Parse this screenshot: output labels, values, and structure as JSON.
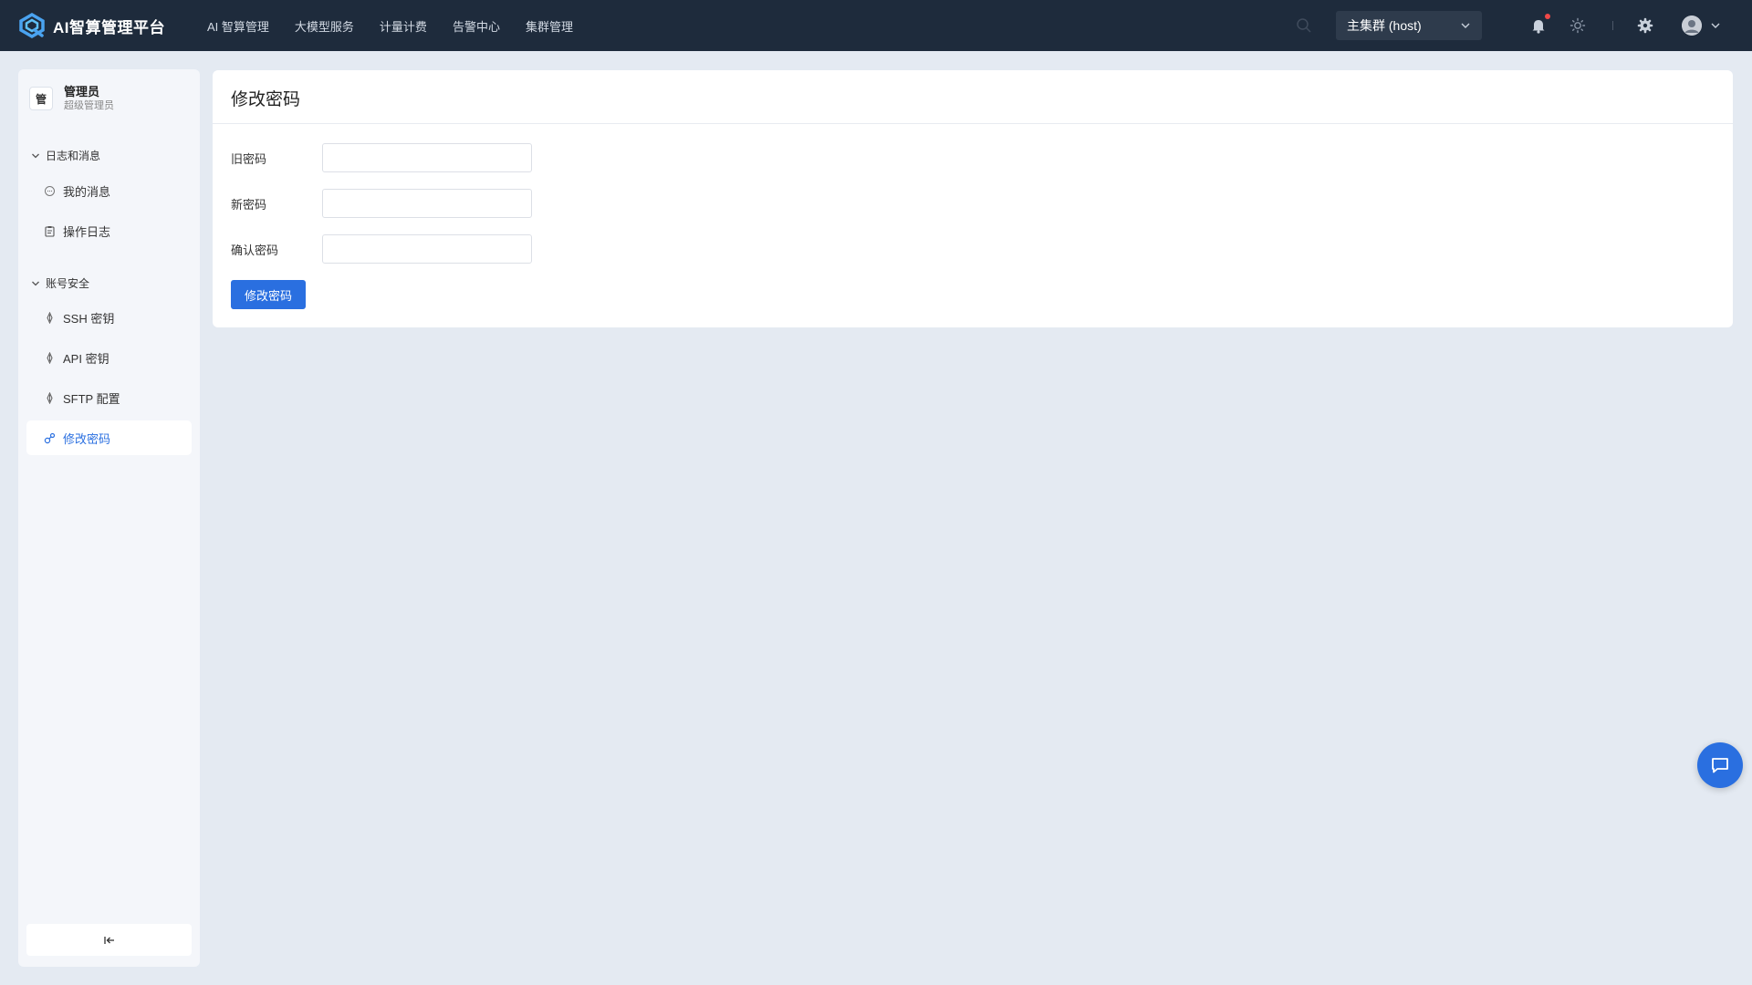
{
  "brand": {
    "name": "AI智算管理平台",
    "accent": "#2a6fe0",
    "topbar_bg": "#1e2b3c"
  },
  "nav": {
    "items": [
      "AI 智算管理",
      "大模型服务",
      "计量计费",
      "告警中心",
      "集群管理"
    ]
  },
  "cluster": {
    "selected": "主集群 (host)"
  },
  "topbar_icons": [
    "search-icon",
    "bell-icon",
    "sun-icon",
    "gear-icon",
    "user-avatar"
  ],
  "user": {
    "badge": "管",
    "name": "管理员",
    "role": "超级管理员"
  },
  "sidebar": {
    "groups": [
      {
        "title": "日志和消息",
        "items": [
          {
            "label": "我的消息",
            "icon": "message-icon"
          },
          {
            "label": "操作日志",
            "icon": "clipboard-icon"
          }
        ]
      },
      {
        "title": "账号安全",
        "items": [
          {
            "label": "SSH 密钥",
            "icon": "key-icon"
          },
          {
            "label": "API 密钥",
            "icon": "key-icon"
          },
          {
            "label": "SFTP 配置",
            "icon": "key-icon"
          },
          {
            "label": "修改密码",
            "icon": "link-key-icon",
            "active": true
          }
        ]
      }
    ],
    "collapse_icon": "collapse-left-icon"
  },
  "main": {
    "title": "修改密码",
    "fields": [
      {
        "label": "旧密码",
        "value": ""
      },
      {
        "label": "新密码",
        "value": ""
      },
      {
        "label": "确认密码",
        "value": ""
      }
    ],
    "submit_label": "修改密码"
  },
  "fab_icon": "chat-icon"
}
